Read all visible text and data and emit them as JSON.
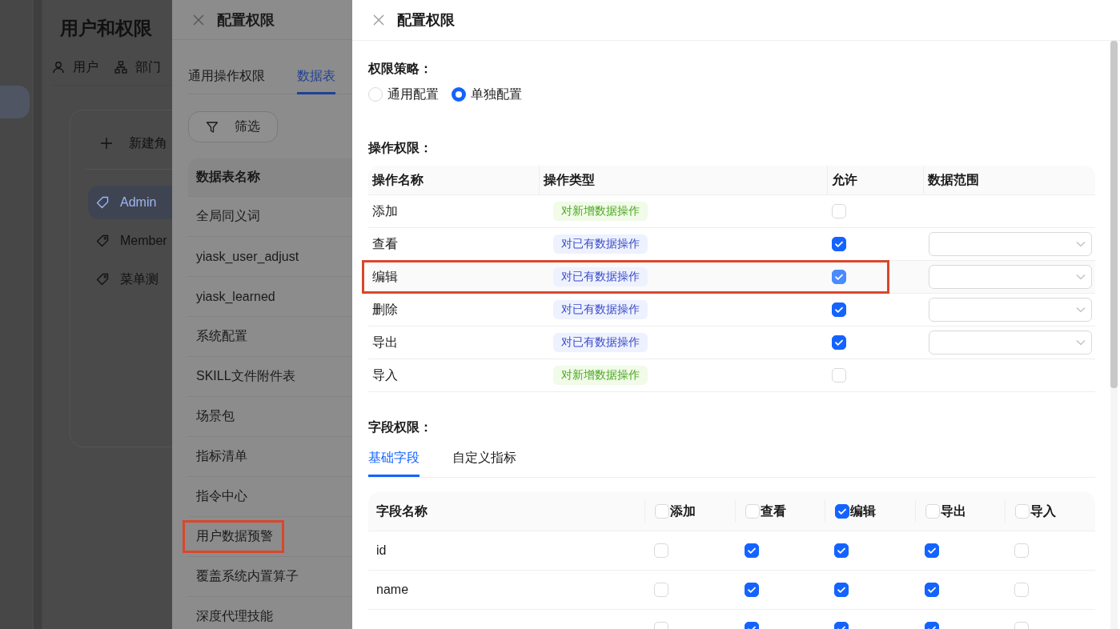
{
  "app": {
    "title": "用户和权限",
    "tabs": [
      {
        "label": "用户",
        "kind": "user"
      },
      {
        "label": "部门",
        "kind": "org"
      }
    ],
    "new_role": "新建角",
    "roles": [
      {
        "label": "Admin",
        "selected": true
      },
      {
        "label": "Member",
        "selected": false
      },
      {
        "label": "菜单测",
        "selected": false
      }
    ]
  },
  "drawer_back": {
    "title": "配置权限",
    "tabs": [
      {
        "label": "通用操作权限",
        "selected": false
      },
      {
        "label": "数据表",
        "selected": true
      }
    ],
    "filter_button": "筛选",
    "column": "数据表名称",
    "rows": [
      {
        "name": "全局同义词",
        "highlighted": false
      },
      {
        "name": "yiask_user_adjust",
        "highlighted": false
      },
      {
        "name": "yiask_learned",
        "highlighted": false
      },
      {
        "name": "系统配置",
        "highlighted": false
      },
      {
        "name": "SKILL文件附件表",
        "highlighted": false
      },
      {
        "name": "场景包",
        "highlighted": false
      },
      {
        "name": "指标清单",
        "highlighted": false
      },
      {
        "name": "指令中心",
        "highlighted": false
      },
      {
        "name": "用户数据预警",
        "highlighted": true
      },
      {
        "name": "覆盖系统内置算子",
        "highlighted": false
      },
      {
        "name": "深度代理技能",
        "highlighted": false
      }
    ]
  },
  "drawer": {
    "title": "配置权限",
    "strategy": {
      "label": "权限策略：",
      "options": [
        {
          "label": "通用配置",
          "selected": false
        },
        {
          "label": "单独配置",
          "selected": true
        }
      ]
    },
    "operations": {
      "label": "操作权限：",
      "columns": [
        "操作名称",
        "操作类型",
        "允许",
        "数据范围"
      ],
      "rows": [
        {
          "name": "添加",
          "type": "对新增数据操作",
          "kind": "new",
          "allowed": false,
          "range_select": false,
          "highlighted": false
        },
        {
          "name": "查看",
          "type": "对已有数据操作",
          "kind": "existing",
          "allowed": true,
          "range_select": true,
          "highlighted": false
        },
        {
          "name": "编辑",
          "type": "对已有数据操作",
          "kind": "existing",
          "allowed": true,
          "range_select": true,
          "highlighted": true
        },
        {
          "name": "删除",
          "type": "对已有数据操作",
          "kind": "existing",
          "allowed": true,
          "range_select": true,
          "highlighted": false
        },
        {
          "name": "导出",
          "type": "对已有数据操作",
          "kind": "existing",
          "allowed": true,
          "range_select": true,
          "highlighted": false
        },
        {
          "name": "导入",
          "type": "对新增数据操作",
          "kind": "new",
          "allowed": false,
          "range_select": false,
          "highlighted": false
        }
      ]
    },
    "fields": {
      "label": "字段权限：",
      "tabs": [
        {
          "label": "基础字段",
          "selected": true
        },
        {
          "label": "自定义指标",
          "selected": false
        }
      ],
      "name_column": "字段名称",
      "columns": [
        {
          "label": "添加",
          "checked": false
        },
        {
          "label": "查看",
          "checked": false
        },
        {
          "label": "编辑",
          "checked": true
        },
        {
          "label": "导出",
          "checked": false
        },
        {
          "label": "导入",
          "checked": false
        }
      ],
      "rows": [
        {
          "name": "id",
          "checks": [
            false,
            true,
            true,
            true,
            false
          ]
        },
        {
          "name": "name",
          "checks": [
            false,
            true,
            true,
            true,
            false
          ]
        },
        {
          "checks": [
            false,
            true,
            true,
            true,
            false
          ]
        }
      ]
    }
  }
}
